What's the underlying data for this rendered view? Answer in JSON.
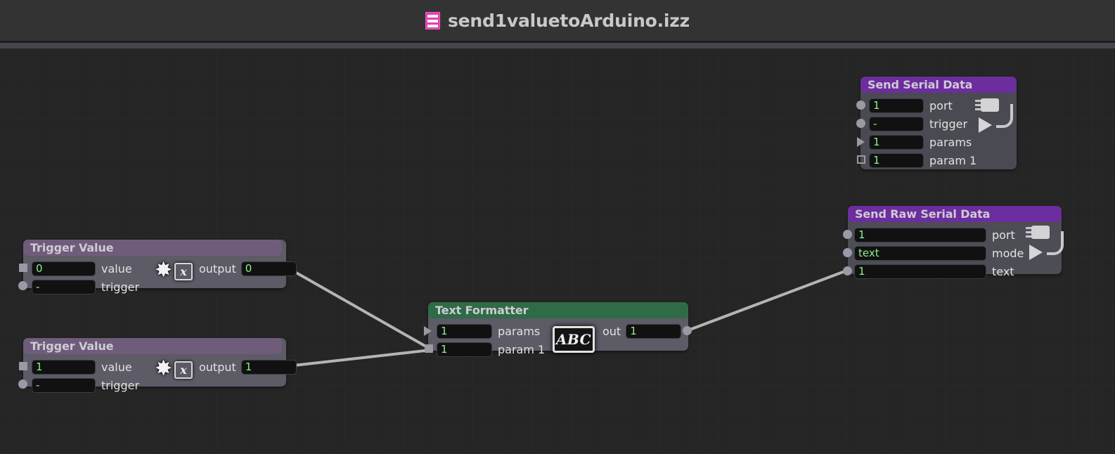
{
  "window": {
    "title": "send1valuetoArduino.izz",
    "doc_icon": "document-sheet-icon",
    "icon_color": "#e63fb0"
  },
  "canvas": {
    "background": "#252525",
    "wire_color": "#b4b4b4"
  },
  "nodes": [
    {
      "id": "trigger1",
      "title": "Trigger Value",
      "header_color": "#6f5c7b",
      "icons": [
        "asterisk-icon",
        "x-box-icon"
      ],
      "inputs": [
        {
          "label": "value",
          "value": "0",
          "port": "square"
        },
        {
          "label": "trigger",
          "value": "-",
          "port": "circle"
        }
      ],
      "outputs": [
        {
          "label": "output",
          "value": "0",
          "port": "square"
        }
      ]
    },
    {
      "id": "trigger2",
      "title": "Trigger Value",
      "header_color": "#6f5c7b",
      "icons": [
        "asterisk-icon",
        "x-box-icon"
      ],
      "inputs": [
        {
          "label": "value",
          "value": "1",
          "port": "square"
        },
        {
          "label": "trigger",
          "value": "-",
          "port": "circle"
        }
      ],
      "outputs": [
        {
          "label": "output",
          "value": "1",
          "port": "square"
        }
      ]
    },
    {
      "id": "textformatter",
      "title": "Text Formatter",
      "header_color": "#2e6b46",
      "icons": [
        "abc-icon"
      ],
      "inputs": [
        {
          "label": "params",
          "value": "1",
          "port": "triangle"
        },
        {
          "label": "param 1",
          "value": "1",
          "port": "square"
        }
      ],
      "outputs": [
        {
          "label": "out",
          "value": "1",
          "port": "circle"
        }
      ]
    },
    {
      "id": "sendserial",
      "title": "Send Serial Data",
      "header_color": "#6c2d9e",
      "icons": [
        "serial-plug-icon",
        "play-triangle-icon"
      ],
      "inputs": [
        {
          "label": "port",
          "value": "1",
          "port": "circle"
        },
        {
          "label": "trigger",
          "value": "-",
          "port": "circle"
        },
        {
          "label": "params",
          "value": "1",
          "port": "triangle"
        },
        {
          "label": "param 1",
          "value": "1",
          "port": "hollow-square"
        }
      ],
      "outputs": []
    },
    {
      "id": "sendraw",
      "title": "Send Raw Serial Data",
      "header_color": "#6c2d9e",
      "icons": [
        "serial-plug-icon",
        "play-triangle-icon"
      ],
      "inputs": [
        {
          "label": "port",
          "value": "1",
          "port": "circle"
        },
        {
          "label": "mode",
          "value": "text",
          "port": "circle"
        },
        {
          "label": "text",
          "value": "1",
          "port": "circle"
        }
      ],
      "outputs": []
    }
  ],
  "connections": [
    {
      "from": "trigger1.output",
      "to": "textformatter.param 1"
    },
    {
      "from": "trigger2.output",
      "to": "textformatter.param 1"
    },
    {
      "from": "textformatter.out",
      "to": "sendraw.text"
    }
  ]
}
